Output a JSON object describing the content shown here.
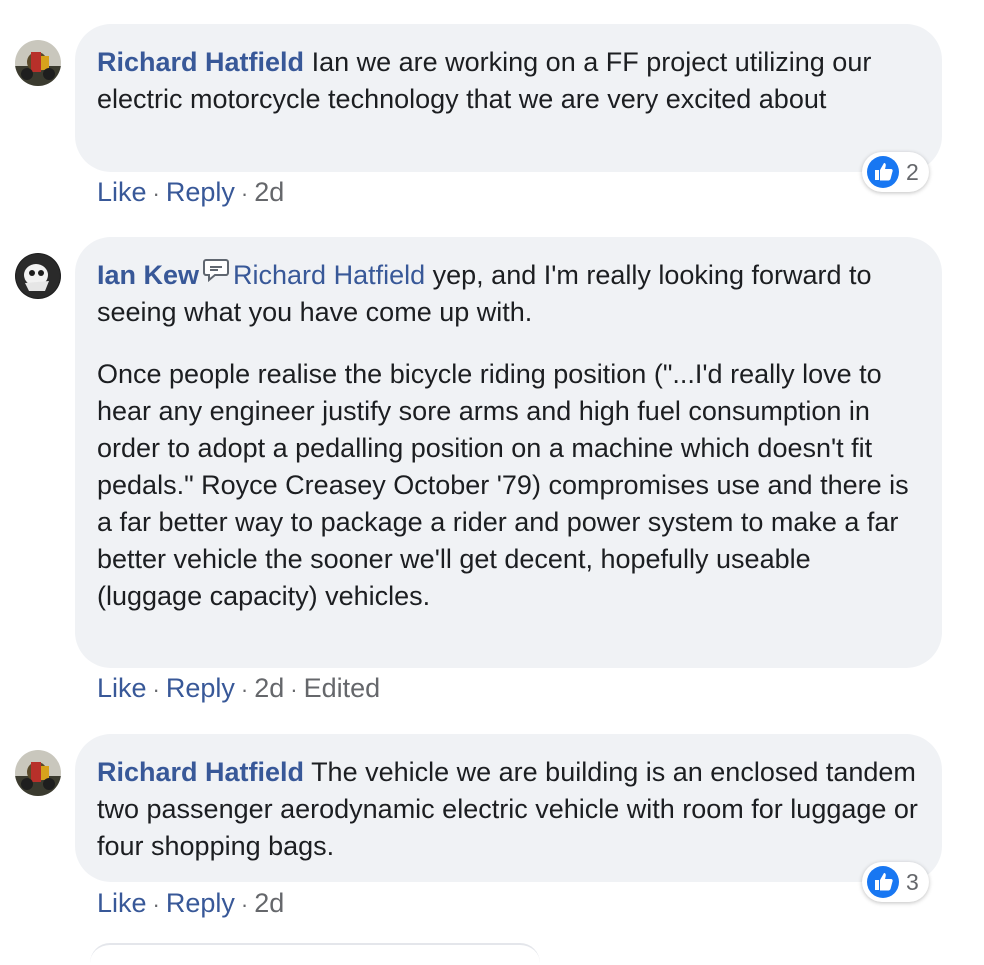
{
  "comments": [
    {
      "author": "Richard Hatfield",
      "mention": "",
      "paragraphs": [
        "Ian we are working on a FF project utilizing our electric motorcycle technology that we are very excited about"
      ],
      "actions": {
        "like": "Like",
        "reply": "Reply",
        "time": "2d",
        "edited": ""
      },
      "reactions": {
        "icon": "thumbs-up-icon",
        "count": "2"
      }
    },
    {
      "author": "Ian Kew",
      "mention": "Richard Hatfield",
      "paragraphs": [
        "yep, and I'm really looking forward to seeing what you have come up with.",
        "Once people realise the bicycle riding position (\"...I'd really love to hear any engineer justify sore arms and high fuel consumption in order to adopt a pedalling position on a machine which doesn't fit pedals.\" Royce Creasey October '79) compromises use and there is a far better way to package a rider and power system to make a far better vehicle the sooner we'll get decent, hopefully useable (luggage capacity) vehicles."
      ],
      "actions": {
        "like": "Like",
        "reply": "Reply",
        "time": "2d",
        "edited": "Edited"
      },
      "reactions": null
    },
    {
      "author": "Richard Hatfield",
      "mention": "",
      "paragraphs": [
        "The vehicle we are building is an enclosed tandem two passenger aerodynamic electric vehicle with room for luggage or four shopping bags."
      ],
      "actions": {
        "like": "Like",
        "reply": "Reply",
        "time": "2d",
        "edited": ""
      },
      "reactions": {
        "icon": "thumbs-up-icon",
        "count": "3"
      }
    }
  ],
  "colors": {
    "link": "#385898",
    "bubble": "#f0f2f5",
    "meta": "#65676b",
    "like_blue": "#1877f2"
  }
}
